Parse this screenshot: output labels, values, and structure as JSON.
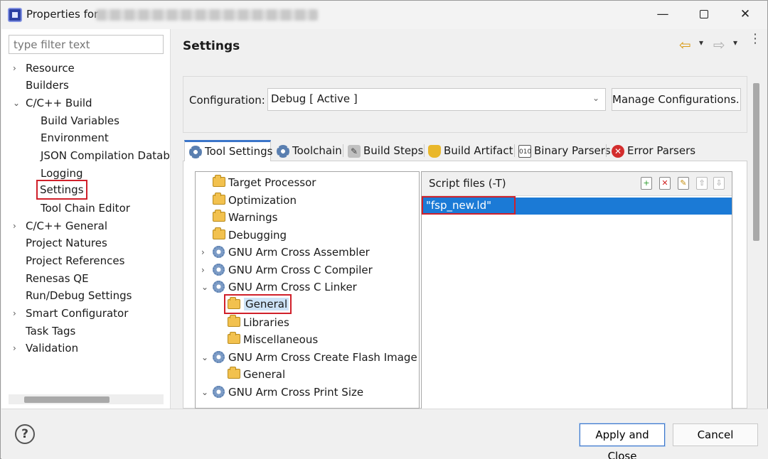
{
  "window": {
    "title_prefix": "Properties for",
    "minimize_label": "—",
    "close_label": "✕"
  },
  "filter": {
    "placeholder": "type filter text"
  },
  "nav": {
    "items": [
      {
        "label": "Resource",
        "has_chevron": true
      },
      {
        "label": "Builders",
        "has_chevron": false
      },
      {
        "label": "C/C++ Build",
        "expanded": true
      },
      {
        "label": "Build Variables"
      },
      {
        "label": "Environment"
      },
      {
        "label": "JSON Compilation Datab"
      },
      {
        "label": "Logging"
      },
      {
        "label": "Settings",
        "selected": true
      },
      {
        "label": "Tool Chain Editor"
      },
      {
        "label": "C/C++ General",
        "has_chevron": true
      },
      {
        "label": "Project Natures"
      },
      {
        "label": "Project References"
      },
      {
        "label": "Renesas QE"
      },
      {
        "label": "Run/Debug Settings"
      },
      {
        "label": "Smart Configurator",
        "has_chevron": true
      },
      {
        "label": "Task Tags"
      },
      {
        "label": "Validation",
        "has_chevron": true
      }
    ]
  },
  "page": {
    "title": "Settings",
    "back_icon": "⇦",
    "forward_icon": "⇨",
    "dropdown_icon": "▾",
    "menu_icon": "⋮"
  },
  "config": {
    "label": "Configuration:",
    "value": "Debug  [ Active ]",
    "caret": "⌄",
    "manage_button": "Manage Configurations..."
  },
  "tabs": [
    {
      "label": "Tool Settings",
      "icon": "gear-icon",
      "active": true
    },
    {
      "label": "Toolchain",
      "icon": "gear-icon"
    },
    {
      "label": "Build Steps",
      "icon": "wrench-icon"
    },
    {
      "label": "Build Artifact",
      "icon": "trophy-icon"
    },
    {
      "label": "Binary Parsers",
      "icon": "binary-icon"
    },
    {
      "label": "Error Parsers",
      "icon": "error-icon"
    }
  ],
  "tree": {
    "items": [
      {
        "label": "Target Processor",
        "icon": "folder"
      },
      {
        "label": "Optimization",
        "icon": "folder"
      },
      {
        "label": "Warnings",
        "icon": "folder"
      },
      {
        "label": "Debugging",
        "icon": "folder"
      },
      {
        "label": "GNU Arm Cross Assembler",
        "icon": "gear",
        "chevron": "›"
      },
      {
        "label": "GNU Arm Cross C Compiler",
        "icon": "gear",
        "chevron": "›"
      },
      {
        "label": "GNU Arm Cross C Linker",
        "icon": "gear",
        "chevron": "⌄"
      },
      {
        "label": "General",
        "icon": "folder",
        "selected": true
      },
      {
        "label": "Libraries",
        "icon": "folder"
      },
      {
        "label": "Miscellaneous",
        "icon": "folder"
      },
      {
        "label": "GNU Arm Cross Create Flash Image",
        "icon": "gear",
        "chevron": "⌄"
      },
      {
        "label": "General",
        "icon": "folder"
      },
      {
        "label": "GNU Arm Cross Print Size",
        "icon": "gear",
        "chevron": "⌄"
      }
    ]
  },
  "script_files": {
    "label": "Script files (-T)",
    "entries": [
      "\"fsp_new.ld\""
    ],
    "toolbar": [
      "add-icon",
      "delete-icon",
      "edit-icon",
      "move-up-icon",
      "move-down-icon"
    ]
  },
  "footer": {
    "help_label": "?",
    "apply_label": "Apply and Close",
    "cancel_label": "Cancel"
  }
}
